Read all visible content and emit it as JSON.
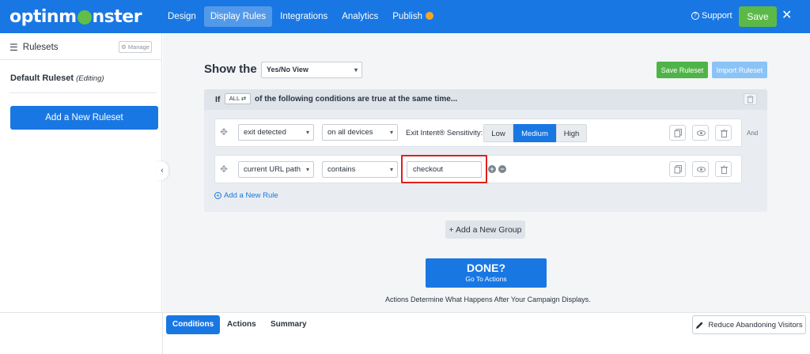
{
  "brand": {
    "logo_text_pre": "optinm",
    "logo_text_post": "nster"
  },
  "nav": {
    "tabs": [
      "Design",
      "Display Rules",
      "Integrations",
      "Analytics",
      "Publish"
    ],
    "active": "Display Rules",
    "support_label": "Support",
    "save_label": "Save",
    "close_icon": "close-icon"
  },
  "sidebar": {
    "title": "Rulesets",
    "manage_label": "Manage",
    "ruleset_name": "Default Ruleset",
    "ruleset_state": "(Editing)",
    "add_ruleset_label": "Add a New Ruleset"
  },
  "main": {
    "show_label": "Show the",
    "view_select": "Yes/No View",
    "save_ruleset_label": "Save Ruleset",
    "import_ruleset_label": "Import Ruleset",
    "group": {
      "if_label": "If",
      "match_mode": "ALL",
      "conditions_text": "of the following conditions are true at the same time..."
    },
    "rules": [
      {
        "condition": "exit detected",
        "operator": "on all devices",
        "intent_label": "Exit Intent® Sensitivity:",
        "sensitivity_options": [
          "Low",
          "Medium",
          "High"
        ],
        "sensitivity_selected": "Medium",
        "connector": "And"
      },
      {
        "condition": "current URL path",
        "operator": "contains",
        "value": "checkout"
      }
    ],
    "add_rule_label": "Add a New Rule",
    "add_group_label": "+ Add a New Group",
    "done_title": "DONE?",
    "done_subtitle": "Go To Actions",
    "actions_note": "Actions Determine What Happens After Your Campaign Displays."
  },
  "bottom": {
    "tabs": [
      "Conditions",
      "Actions",
      "Summary"
    ],
    "active": "Conditions",
    "reduce_label": "Reduce Abandoning Visitors"
  },
  "colors": {
    "primary": "#1977e3",
    "success": "#5cb948",
    "highlight": "#e0201b"
  }
}
